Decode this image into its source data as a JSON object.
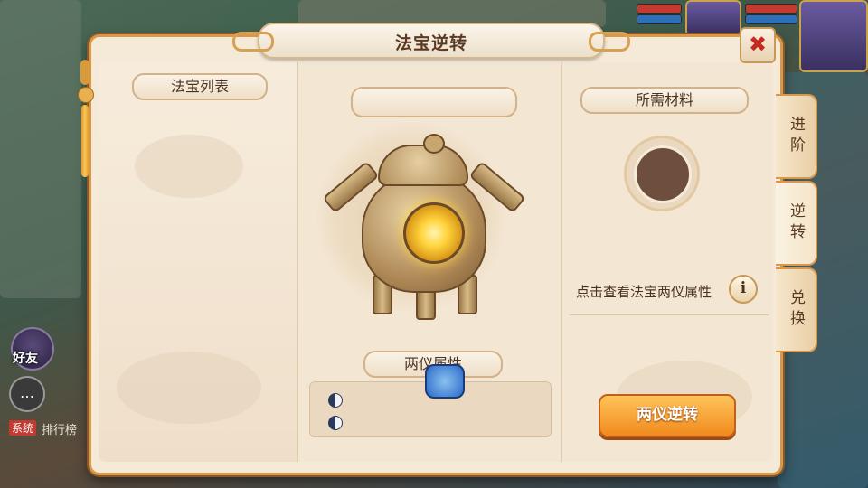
{
  "window": {
    "title": "法宝逆转",
    "close_label": "✖"
  },
  "left_column": {
    "header": "法宝列表"
  },
  "center": {
    "treasure_name": "",
    "attributes_header": "两仪属性",
    "attribute_rows": [
      "",
      ""
    ]
  },
  "right_column": {
    "materials_header": "所需材料",
    "hint": "点击查看法宝两仪属性",
    "info_icon": "i",
    "action_button": "两仪逆转"
  },
  "side_tabs": [
    {
      "label": "进阶",
      "active": false
    },
    {
      "label": "逆转",
      "active": true
    },
    {
      "label": "兑换",
      "active": false
    }
  ],
  "background_hud": {
    "friends_label": "好友",
    "chat_channel": "系统",
    "ranking_label": "排行榜"
  },
  "colors": {
    "panel_bg": "#f5e9d8",
    "frame_gold": "#d89a4a",
    "action_orange": "#f08a1e",
    "close_red": "#c8281e",
    "text_brown": "#4a3220"
  }
}
